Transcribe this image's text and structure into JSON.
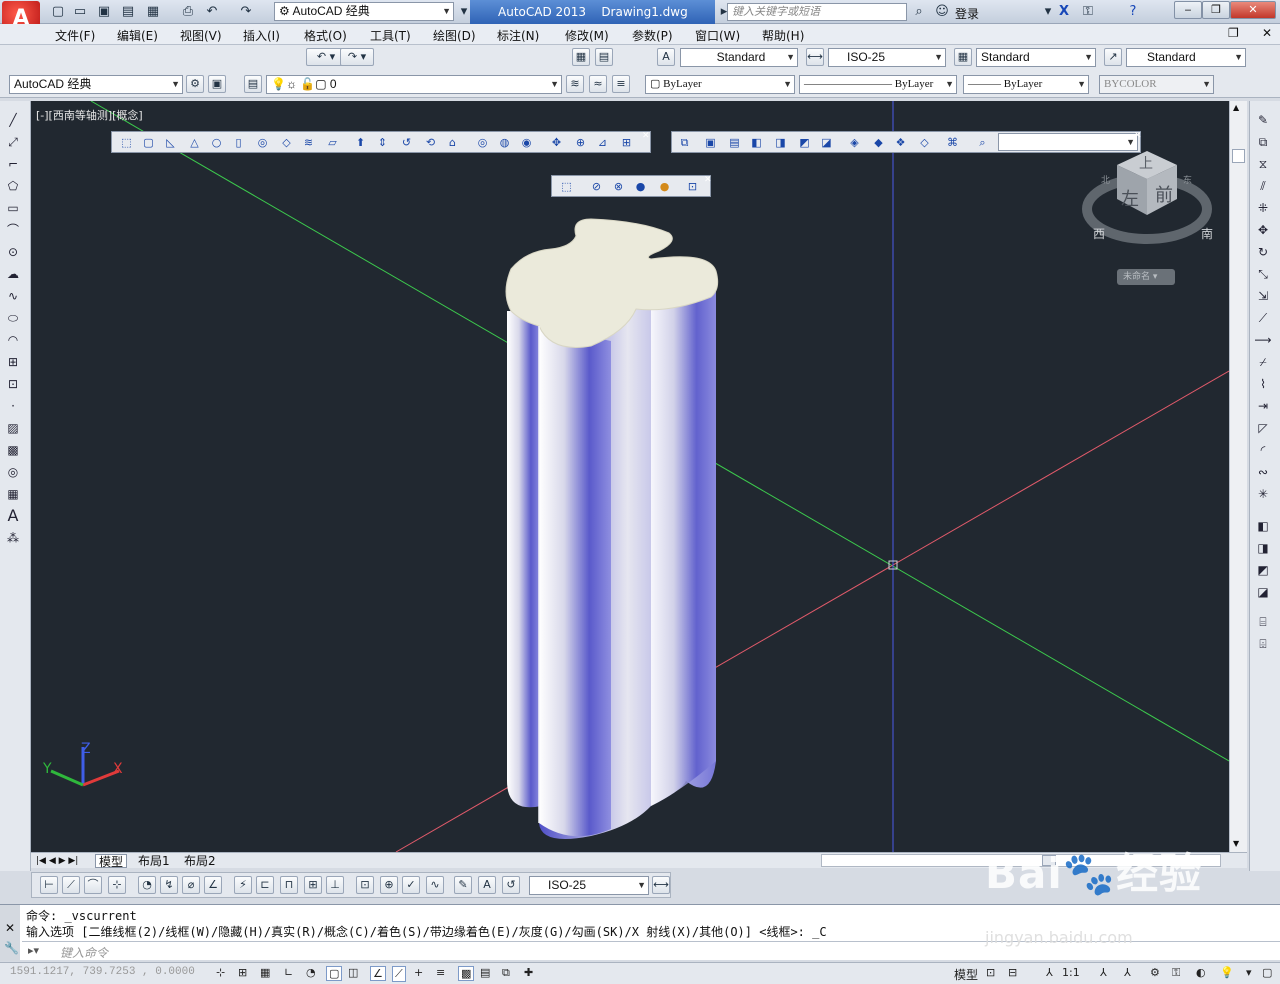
{
  "titlebar": {
    "workspace": "AutoCAD 经典",
    "app_name": "AutoCAD 2013",
    "document": "Drawing1.dwg",
    "search_placeholder": "键入关键字或短语",
    "login": "登录"
  },
  "menu": [
    "文件(F)",
    "编辑(E)",
    "视图(V)",
    "插入(I)",
    "格式(O)",
    "工具(T)",
    "绘图(D)",
    "标注(N)",
    "修改(M)",
    "参数(P)",
    "窗口(W)",
    "帮助(H)"
  ],
  "styles": {
    "text_style": "Standard",
    "dim_style": "ISO-25",
    "table_style": "Standard",
    "multileader_style": "Standard"
  },
  "layers": {
    "workspace": "AutoCAD 经典",
    "layer": "0",
    "color": "ByLayer",
    "linetype": "ByLayer",
    "lineweight": "ByLayer",
    "plot_style": "BYCOLOR"
  },
  "viewport": {
    "label": "[-][西南等轴测][概念]",
    "viewcube_top": "上",
    "viewcube_left": "左",
    "viewcube_front": "前",
    "compass_west": "西",
    "compass_south": "南",
    "compass_north": "北",
    "compass_east": "东",
    "ucs_menu": "未命名",
    "axis_x": "X",
    "axis_y": "Y",
    "axis_z": "Z"
  },
  "layout_tabs": [
    "模型",
    "布局1",
    "布局2"
  ],
  "dim_toolbar": {
    "dim_style": "ISO-25"
  },
  "command": {
    "line1": "命令: _vscurrent",
    "line2": "输入选项 [二维线框(2)/线框(W)/隐藏(H)/真实(R)/概念(C)/着色(S)/带边缘着色(E)/灰度(G)/勾画(SK)/X 射线(X)/其他(O)] <线框>: _C",
    "input_placeholder": "键入命令"
  },
  "status": {
    "coords": "1591.1217, 739.7253 , 0.0000",
    "model": "模型",
    "scale": "1:1"
  },
  "watermark": {
    "brand": "Bai",
    "brand2": "经验",
    "url": "jingyan.baidu.com"
  },
  "colors": {
    "viewport_bg": "#212830",
    "solid_face": "#5c5ccc",
    "solid_cap": "#ebeadb",
    "axis_green": "#39c24a",
    "axis_red": "#e05060",
    "axis_blue": "#4a60e8"
  }
}
